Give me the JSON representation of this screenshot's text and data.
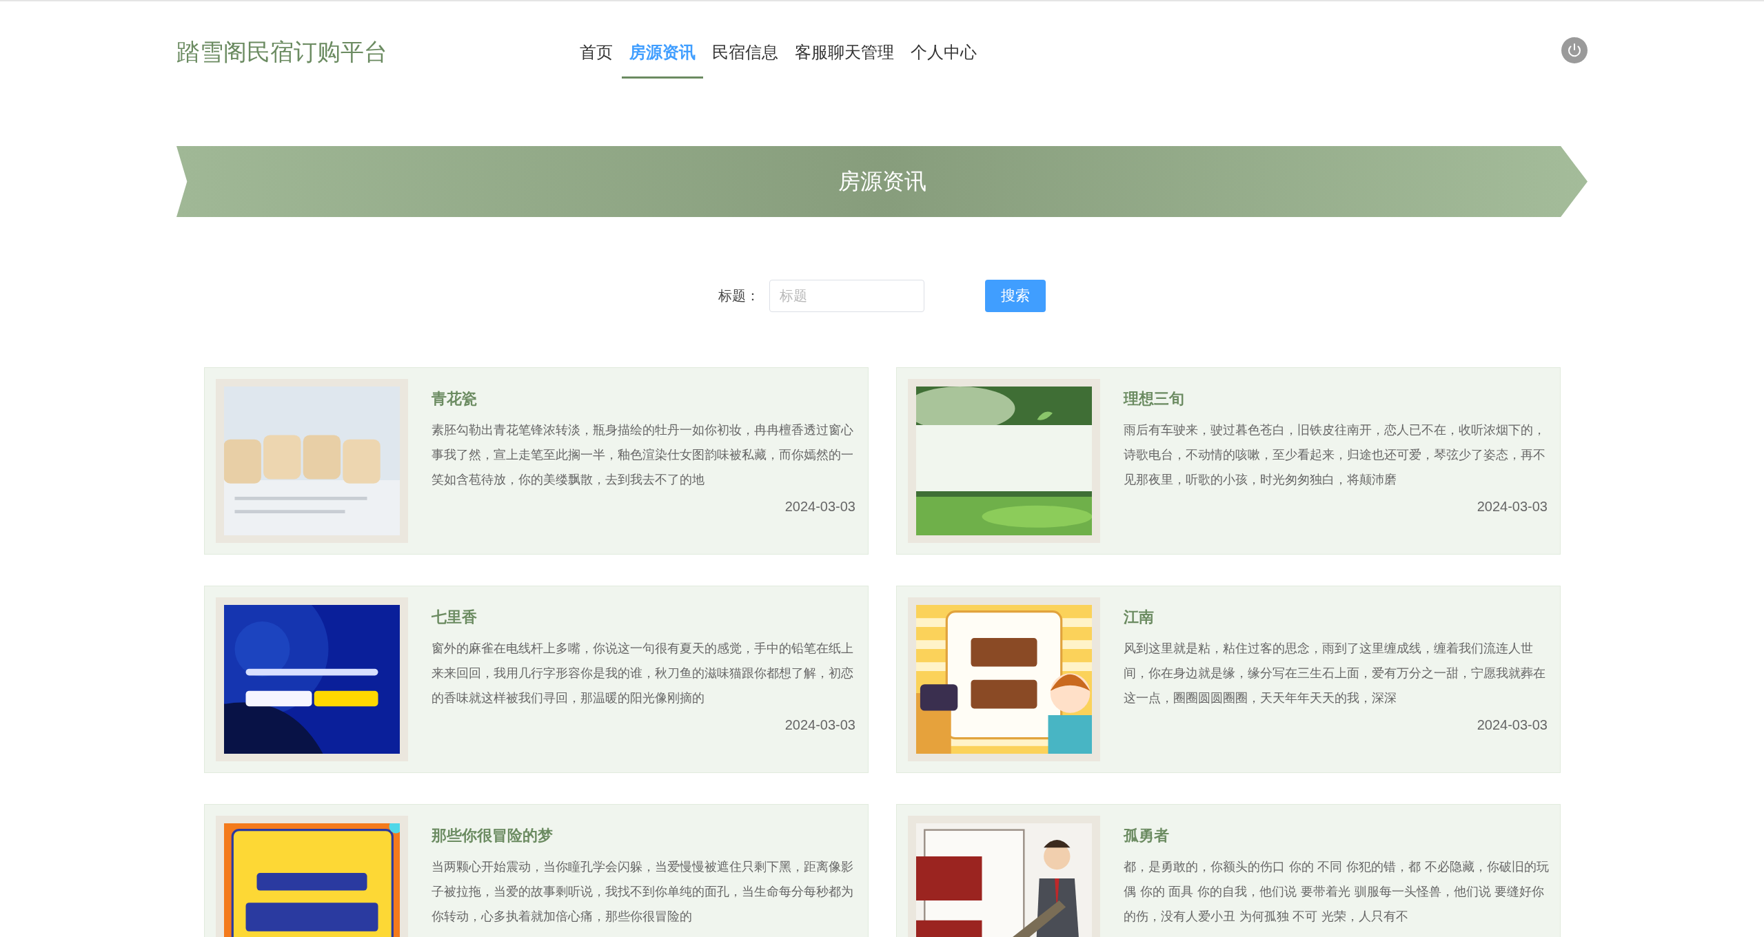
{
  "header": {
    "logo": "踏雪阁民宿订购平台",
    "nav": [
      {
        "label": "首页",
        "selected": false
      },
      {
        "label": "房源资讯",
        "selected": true
      },
      {
        "label": "民宿信息",
        "selected": false
      },
      {
        "label": "客服聊天管理",
        "selected": false
      },
      {
        "label": "个人中心",
        "selected": false
      }
    ]
  },
  "banner": {
    "title": "房源资讯"
  },
  "search": {
    "label": "标题：",
    "placeholder": "标题",
    "button": "搜索"
  },
  "news": [
    {
      "title": "青花瓷",
      "summary": "素胚勾勒出青花笔锋浓转淡，瓶身描绘的牡丹一如你初妆，冉冉檀香透过窗心事我了然，宣上走笔至此搁一半，釉色渲染仕女图韵味被私藏，而你嫣然的一笑如含苞待放，你的美缕飘散，去到我去不了的地",
      "date": "2024-03-03"
    },
    {
      "title": "理想三旬",
      "summary": "雨后有车驶来，驶过暮色苍白，旧铁皮往南开，恋人已不在，收听浓烟下的，诗歌电台，不动情的咳嗽，至少看起来，归途也还可爱，琴弦少了姿态，再不见那夜里，听歌的小孩，时光匆匆独白，将颠沛磨",
      "date": "2024-03-03"
    },
    {
      "title": "七里香",
      "summary": "窗外的麻雀在电线杆上多嘴，你说这一句很有夏天的感觉，手中的铅笔在纸上来来回回，我用几行字形容你是我的谁，秋刀鱼的滋味猫跟你都想了解，初恋的香味就这样被我们寻回，那温暖的阳光像刚摘的",
      "date": "2024-03-03"
    },
    {
      "title": "江南",
      "summary": "风到这里就是粘，粘住过客的思念，雨到了这里缠成线，缠着我们流连人世间，你在身边就是缘，缘分写在三生石上面，爱有万分之一甜，宁愿我就葬在这一点，圈圈圆圆圈圈，天天年年天天的我，深深",
      "date": "2024-03-03"
    },
    {
      "title": "那些你很冒险的梦",
      "summary": "当两颗心开始震动，当你瞳孔学会闪躲，当爱慢慢被遮住只剩下黑，距离像影子被拉拖，当爱的故事剩听说，我找不到你单纯的面孔，当生命每分每秒都为你转动，心多执着就加倍心痛，那些你很冒险的"
    },
    {
      "title": "孤勇者",
      "summary": "都，是勇敢的，你额头的伤口 你的 不同 你犯的错，都 不必隐藏，你破旧的玩偶 你的 面具 你的自我，他们说 要带着光 驯服每一头怪兽，他们说 要缝好你的伤，没有人爱小丑 为何孤独 不可 光荣，人只有不"
    }
  ]
}
